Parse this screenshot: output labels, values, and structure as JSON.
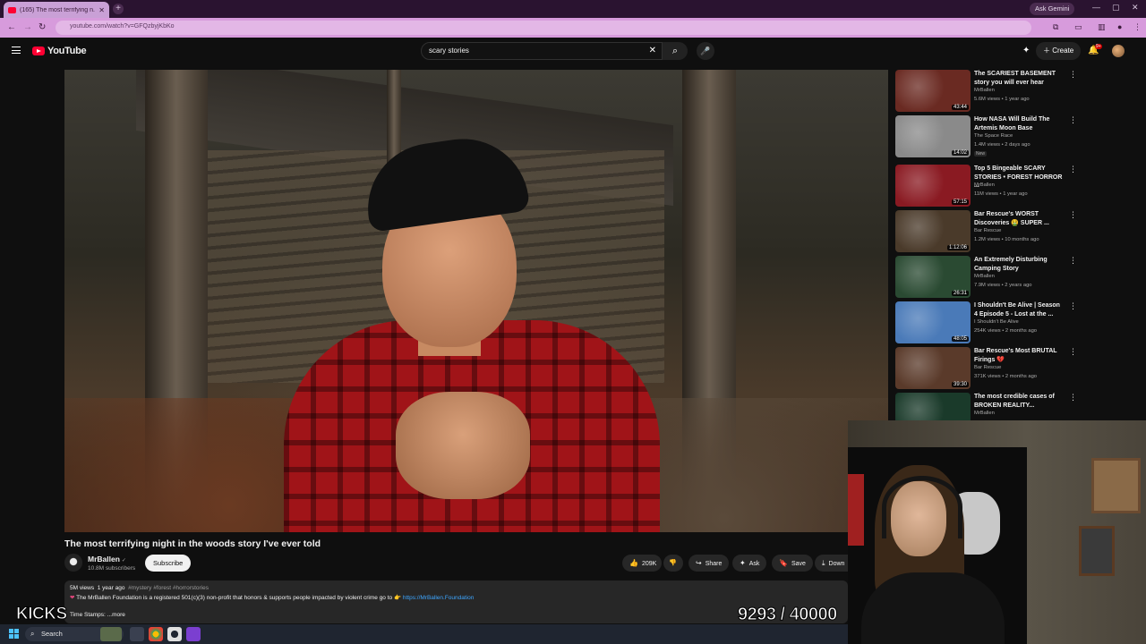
{
  "browser": {
    "tab_title": "(165) The most terrifying n...",
    "tab_close": "✕",
    "new_tab": "+",
    "ask_gemini": "Ask Gemini",
    "url": "youtube.com/watch?v=GFQzbyjKbKo",
    "window_controls": [
      "—",
      "▢",
      "✕"
    ]
  },
  "header": {
    "logo_text": "YouTube",
    "search_value": "scary stories",
    "create_label": "Create",
    "notif_badge": "9+"
  },
  "video": {
    "title": "The most terrifying night in the woods story I've ever told",
    "channel_name": "MrBallen",
    "channel_verified": "✓",
    "subscribers": "10.8M subscribers",
    "subscribe_label": "Subscribe",
    "like_count": "209K",
    "share_label": "Share",
    "ask_label": "Ask",
    "save_label": "Save",
    "download_label": "Down"
  },
  "description": {
    "views": "5M views",
    "age": "1 year ago",
    "tags": "#mystery #forest #horrorstories",
    "line2_text": "The MrBallen Foundation is a registered 501(c)(3) non-profit that honors & supports people impacted by violent crime go to 👉",
    "link": "https://MrBallen.Foundation",
    "line3": "Time Stamps: ...more"
  },
  "overlays": {
    "left_text": "KICKS",
    "counter": "9293 / 40000"
  },
  "sidebar": {
    "items": [
      {
        "title": "The SCARIEST BASEMENT story you will ever hear",
        "channel": "MrBallen",
        "meta": "5.6M views • 1 year ago",
        "duration": "43:44",
        "badge": "",
        "thumb_color": "#6a2a22"
      },
      {
        "title": "How NASA Will Build The Artemis Moon Base",
        "channel": "The Space Race",
        "meta": "1.4M views • 2 days ago",
        "duration": "14:02",
        "badge": "New",
        "thumb_color": "#8a8a8a"
      },
      {
        "title": "Top 5 Bingeable SCARY STORIES • FOREST HORROR ...",
        "channel": "MrBallen",
        "meta": "11M views • 1 year ago",
        "duration": "57:15",
        "badge": "",
        "thumb_color": "#8a1a22"
      },
      {
        "title": "Bar Rescue's WORST Discoveries 🤮 SUPER ...",
        "channel": "Bar Rescue",
        "meta": "1.2M views • 10 months ago",
        "duration": "1:12:06",
        "badge": "",
        "thumb_color": "#4a3a2a"
      },
      {
        "title": "An Extremely Disturbing Camping Story",
        "channel": "MrBallen",
        "meta": "7.9M views • 2 years ago",
        "duration": "26:31",
        "badge": "",
        "thumb_color": "#2a4a32"
      },
      {
        "title": "I Shouldn't Be Alive | Season 4 Episode 5 - Lost at the ...",
        "channel": "I Shouldn't Be Alive",
        "meta": "254K views • 2 months ago",
        "duration": "48:05",
        "badge": "",
        "thumb_color": "#4a7ab8"
      },
      {
        "title": "Bar Rescue's Most BRUTAL Firings 💔",
        "channel": "Bar Rescue",
        "meta": "371K views • 2 months ago",
        "duration": "39:30",
        "badge": "",
        "thumb_color": "#5a3a2a"
      },
      {
        "title": "The most credible cases of BROKEN REALITY...",
        "channel": "MrBallen",
        "meta": "",
        "duration": "",
        "badge": "",
        "thumb_color": "#1a3a2a"
      }
    ]
  },
  "taskbar": {
    "search_label": "Search"
  },
  "colors": {
    "accent_red": "#ff0033",
    "link_blue": "#3ea6ff",
    "browser_pink": "#d79bdc"
  }
}
